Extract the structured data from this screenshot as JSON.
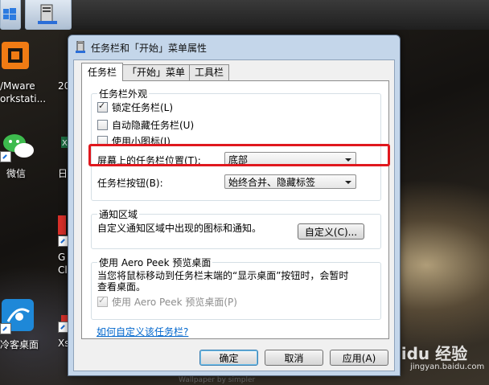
{
  "dialog": {
    "title": "任务栏和「开始」菜单属性",
    "tabs": [
      {
        "label": "任务栏",
        "active": true
      },
      {
        "label": "「开始」菜单",
        "active": false
      },
      {
        "label": "工具栏",
        "active": false
      }
    ]
  },
  "appearance": {
    "group_title": "任务栏外观",
    "lock_taskbar": {
      "label": "锁定任务栏(L)",
      "checked": true
    },
    "autohide": {
      "label": "自动隐藏任务栏(U)",
      "checked": false
    },
    "small_icons": {
      "label": "使用小图标(I)",
      "checked": false
    },
    "location_label": "屏幕上的任务栏位置(T):",
    "location_value": "底部",
    "buttons_label": "任务栏按钮(B):",
    "buttons_value": "始终合并、隐藏标签"
  },
  "notification": {
    "group_title": "通知区域",
    "description": "自定义通知区域中出现的图标和通知。",
    "customize_button": "自定义(C)..."
  },
  "peek": {
    "group_title": "使用 Aero Peek 预览桌面",
    "description_line1": "当您将鼠标移动到任务栏末端的“显示桌面”按钮时，会暂时",
    "description_line2": "查看桌面。",
    "checkbox": {
      "label": "使用 Aero Peek 预览桌面(P)",
      "checked": true,
      "enabled": false
    }
  },
  "help_link": "如何自定义该任务栏?",
  "footer": {
    "ok": "确定",
    "cancel": "取消",
    "apply": "应用(A)"
  },
  "desktop": {
    "icons": [
      {
        "label_line1": "/Mware",
        "label_line2": "orkstati..."
      },
      {
        "label_line1": "20",
        "label_line2": ""
      },
      {
        "label_line1": "微信",
        "label_line2": ""
      },
      {
        "label_line1": "日",
        "label_line2": ""
      },
      {
        "label_line1": "G",
        "label_line2": "Cl"
      },
      {
        "label_line1": "冷客桌面",
        "label_line2": ""
      },
      {
        "label_line1": "Xs",
        "label_line2": ""
      }
    ],
    "watermark": "Baidu 经验",
    "watermark_sub": "jingyan.baidu.com",
    "bg_credit": "Wallpaper by simpler"
  },
  "colors": {
    "highlight": "#e0181e",
    "link": "#0066cc",
    "dialog_frame": "#c4d6ea"
  }
}
